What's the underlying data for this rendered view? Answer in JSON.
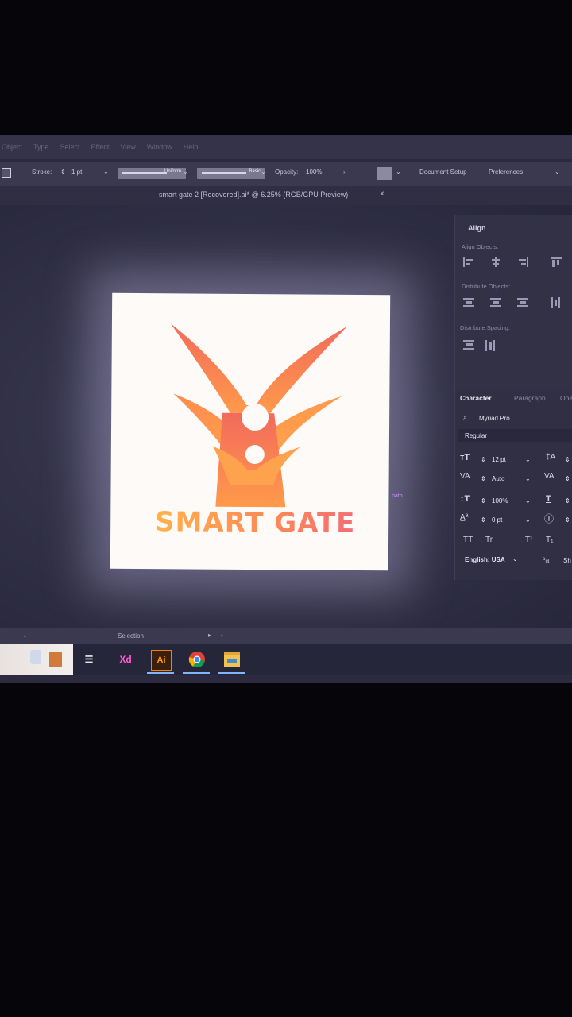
{
  "menubar": {
    "items": [
      "Object",
      "Type",
      "Select",
      "Effect",
      "View",
      "Window",
      "Help"
    ]
  },
  "controlbar": {
    "stroke_label": "Stroke:",
    "stroke_value": "1 pt",
    "profile_1": "Uniform",
    "profile_2": "Basic",
    "opacity_label": "Opacity:",
    "opacity_value": "100%",
    "document_setup": "Document Setup",
    "preferences": "Preferences"
  },
  "document_tab": {
    "title": "smart gate 2 [Recovered].ai* @ 6.25% (RGB/GPU Preview)",
    "close": "×"
  },
  "artboard": {
    "logo_text": "SMART GATE",
    "colors": {
      "orange": "#ff8a4a",
      "red": "#f06a5e",
      "yellow": "#ffc04a"
    }
  },
  "cursor_tooltip": "path",
  "align_panel": {
    "title": "Align",
    "align_objects_label": "Align Objects:",
    "distribute_objects_label": "Distribute Objects:",
    "distribute_spacing_label": "Distribute Spacing:"
  },
  "character_panel": {
    "tabs": [
      "Character",
      "Paragraph",
      "Ope"
    ],
    "font_family": "Myriad Pro",
    "font_style": "Regular",
    "font_size": "12 pt",
    "kerning": "Auto",
    "vertical_scale": "100%",
    "baseline_shift": "0 pt",
    "caps_1": "TT",
    "caps_2": "Tr",
    "superscript": "T¹",
    "subscript": "T₁",
    "language": "English: USA",
    "sharp": "Sh"
  },
  "statusbar": {
    "tool": "Selection"
  },
  "taskbar": {
    "apps": [
      "task-view",
      "xd",
      "illustrator",
      "chrome",
      "file-explorer"
    ],
    "xd_label": "Xd",
    "ai_label": "Ai"
  }
}
